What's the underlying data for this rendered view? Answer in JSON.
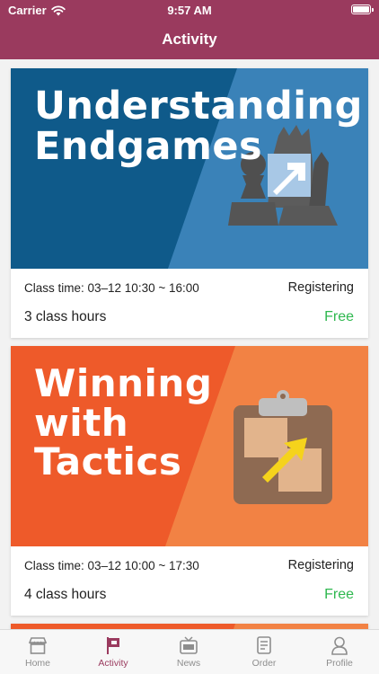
{
  "status_bar": {
    "carrier": "Carrier",
    "time": "9:57 AM"
  },
  "header": {
    "title": "Activity"
  },
  "colors": {
    "accent": "#9a3a5e",
    "price_green": "#2fb84f"
  },
  "cards": [
    {
      "banner_line1": "Understanding",
      "banner_line2": "Endgames",
      "class_time": "Class time: 03–12 10:30 ~ 16:00",
      "status": "Registering",
      "hours": "3 class hours",
      "price": "Free",
      "icon": "chess-pieces-arrow-icon",
      "banner_color": "#0f5a8a"
    },
    {
      "banner_line1": "Winning",
      "banner_line2": "with",
      "banner_line3": "Tactics",
      "class_time": "Class time: 03–12 10:00 ~ 17:30",
      "status": "Registering",
      "hours": "4 class hours",
      "price": "Free",
      "icon": "clipboard-arrow-icon",
      "banner_color": "#ee5a2a"
    }
  ],
  "tabs": [
    {
      "label": "Home",
      "icon": "store-icon",
      "active": false
    },
    {
      "label": "Activity",
      "icon": "flag-icon",
      "active": true
    },
    {
      "label": "News",
      "icon": "tv-news-icon",
      "active": false
    },
    {
      "label": "Order",
      "icon": "document-icon",
      "active": false
    },
    {
      "label": "Profile",
      "icon": "user-icon",
      "active": false
    }
  ]
}
